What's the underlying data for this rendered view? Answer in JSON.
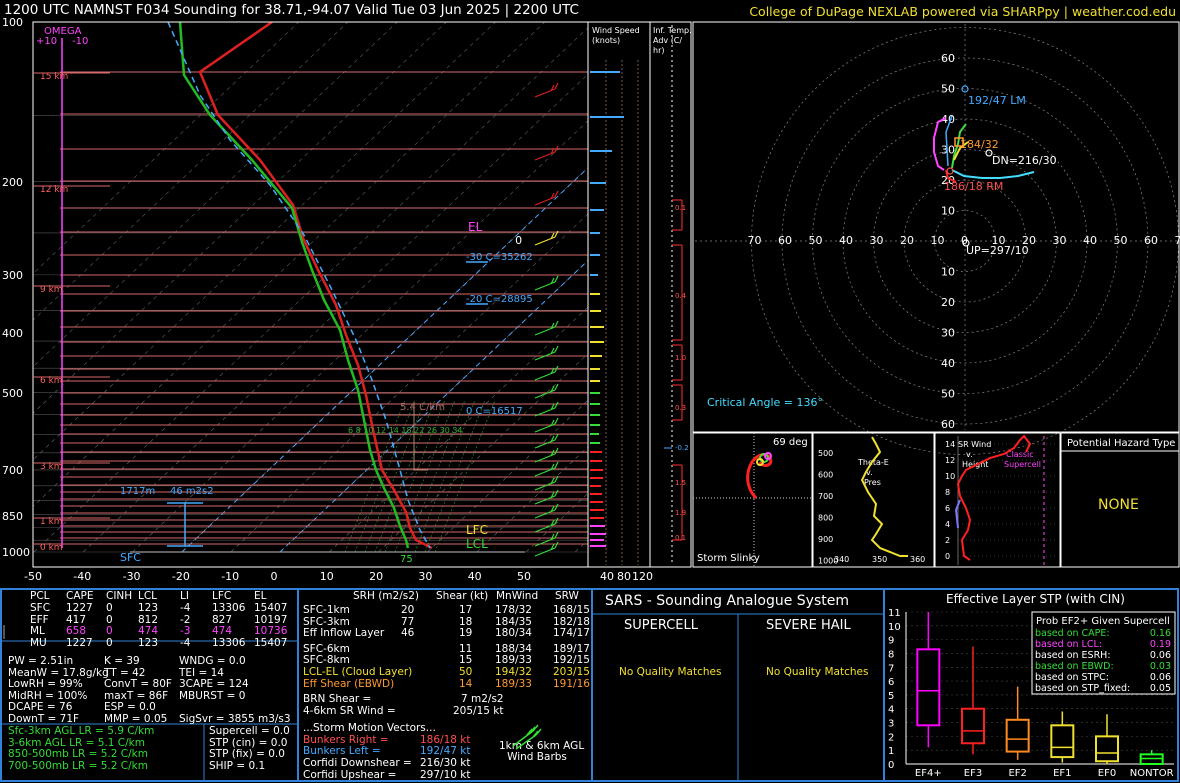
{
  "header": {
    "title": "1200 UTC NAMNST F034 Sounding for 38.71,-94.07 Valid  Tue 03 Jun 2025 | 2200 UTC",
    "credit": "College of DuPage NEXLAB powered via SHARPpy | weather.cod.edu"
  },
  "skewt": {
    "omega_label": "OMEGA",
    "omega_ticks": [
      "+10",
      "-10"
    ],
    "pressure_labels": [
      "100",
      "200",
      "300",
      "400",
      "500",
      "700",
      "850",
      "1000"
    ],
    "temp_labels": [
      "-50",
      "-40",
      "-30",
      "-20",
      "-10",
      "0",
      "10",
      "20",
      "30",
      "40",
      "50"
    ],
    "height_labels": [
      "15 km",
      "12 km",
      "9 km",
      "6 km",
      "3 km",
      "1 km",
      "0 km"
    ],
    "annotations": {
      "el": "EL",
      "lfc": "LFC",
      "lcl": "LCL",
      "sfc": "SFC",
      "iso30": "-30 C=35262",
      "iso20": "-20 C=28895",
      "iso0": "0 C=16517",
      "lapse": "5.4 C/km",
      "pbl": "1717m",
      "dcape": "46 m2s2",
      "sfc_temp": "75",
      "mix_ratios": "6  8  10 12  14  18  22 26 30 34"
    }
  },
  "wind_speed_panel": {
    "title": "Wind Speed (knots)",
    "ticks": [
      "40",
      "80",
      "120"
    ]
  },
  "temp_adv_panel": {
    "title": "Inf. Temp. Adv (C/hr)",
    "labels": [
      "0.1",
      "0.4",
      "1.0",
      "0.3",
      "-0.2",
      "1.5",
      "1.9",
      "0.1"
    ]
  },
  "hodograph": {
    "rings_upper": [
      "60",
      "50",
      "40",
      "30",
      "20",
      "10"
    ],
    "rings_lower": [
      "10",
      "20",
      "30",
      "40",
      "50",
      "60"
    ],
    "axis_left": [
      "0",
      "70",
      "60",
      "50",
      "40",
      "30",
      "20",
      "10"
    ],
    "axis_right": [
      "0",
      "10",
      "20",
      "30",
      "40",
      "50",
      "60",
      "70"
    ],
    "lm": "192/47 LM",
    "mean": "184/32",
    "dn": "DN=216/30",
    "rm": "186/18 RM",
    "up": "UP=297/10",
    "critical_angle": "Critical Angle = 136°"
  },
  "storm_slinky": {
    "angle": "69 deg",
    "label": "Storm Slinky"
  },
  "theta_e": {
    "label": "Theta-E v. Pres",
    "p_ticks": [
      "500",
      "600",
      "700",
      "800",
      "900",
      "1000"
    ],
    "t_ticks": [
      "340",
      "350",
      "360"
    ]
  },
  "sr_wind": {
    "label": "SR Wind v. Height",
    "classic": "Classic Supercell",
    "h_ticks": [
      "14",
      "12",
      "10",
      "8",
      "6",
      "4",
      "2",
      "0"
    ]
  },
  "hazard": {
    "title": "Potential Hazard Type",
    "value": "NONE"
  },
  "parcels": {
    "headers": [
      "PCL",
      "CAPE",
      "CINH",
      "LCL",
      "LI",
      "LFC",
      "EL"
    ],
    "rows": [
      [
        "SFC",
        "1227",
        "0",
        "123",
        "-4",
        "13306",
        "15407"
      ],
      [
        "EFF",
        "417",
        "0",
        "812",
        "-2",
        "827",
        "10197"
      ],
      [
        "ML",
        "658",
        "0",
        "474",
        "-3",
        "474",
        "10736"
      ],
      [
        "MU",
        "1227",
        "0",
        "123",
        "-4",
        "13306",
        "15407"
      ]
    ]
  },
  "indices": [
    [
      "PW = 2.51in",
      "K = 39",
      "WNDG = 0.0"
    ],
    [
      "MeanW = 17.8g/kg",
      "TT = 42",
      "TEI = 14"
    ],
    [
      "LowRH = 99%",
      "ConvT = 80F",
      "3CAPE = 124"
    ],
    [
      "MidRH = 100%",
      "maxT = 86F",
      "MBURST = 0"
    ],
    [
      "DCAPE = 76",
      "ESP = 0.0",
      ""
    ],
    [
      "DownT = 71F",
      "MMP = 0.05",
      "SigSvr = 3855 m3/s3"
    ]
  ],
  "lapse_rates": [
    "Sfc-3km AGL LR = 5.9 C/km",
    "3-6km AGL LR = 5.1 C/km",
    "850-500mb LR = 5.2 C/km",
    "700-500mb LR = 5.2 C/km"
  ],
  "composites": [
    "Supercell = 0.0",
    "STP (cin) = 0.0",
    "STP (fix) = 0.0",
    "SHIP = 0.1"
  ],
  "kinematics": {
    "headers": [
      "SRH (m2/s2)",
      "Shear (kt)",
      "MnWind",
      "SRW"
    ],
    "group1": [
      [
        "SFC-1km",
        "20",
        "17",
        "178/32",
        "168/15"
      ],
      [
        "SFC-3km",
        "77",
        "18",
        "184/35",
        "182/18"
      ],
      [
        "Eff Inflow Layer",
        "46",
        "19",
        "180/34",
        "174/17"
      ]
    ],
    "group2": [
      [
        "SFC-6km",
        "11",
        "188/34",
        "189/17"
      ],
      [
        "SFC-8km",
        "15",
        "189/33",
        "192/15"
      ],
      [
        "LCL-EL (Cloud Layer)",
        "50",
        "194/32",
        "203/15"
      ],
      [
        "Eff Shear (EBWD)",
        "14",
        "189/33",
        "191/16"
      ]
    ],
    "brn_label": "BRN Shear =",
    "brn_value": "7 m2/s2",
    "srw_label": "4-6km SR Wind =",
    "srw_value": "205/15 kt",
    "vectors_title": "...Storm Motion Vectors...",
    "vectors": [
      [
        "Bunkers Right =",
        "186/18 kt"
      ],
      [
        "Bunkers Left =",
        "192/47 kt"
      ],
      [
        "Corfidi Downshear =",
        "216/30 kt"
      ],
      [
        "Corfidi Upshear =",
        "297/10 kt"
      ]
    ],
    "barbs_label1": "1km & 6km AGL",
    "barbs_label2": "Wind Barbs"
  },
  "sars": {
    "title": "SARS - Sounding Analogue System",
    "supercell": "SUPERCELL",
    "hail": "SEVERE HAIL",
    "supercell_msg": "No Quality Matches",
    "hail_msg": "No Quality Matches"
  },
  "stp": {
    "title": "Effective Layer STP (with CIN)",
    "legend_title": "Prob EF2+ Given Supercell",
    "legend": [
      [
        "based on CAPE:",
        "0.16"
      ],
      [
        "based on LCL:",
        "0.19"
      ],
      [
        "based on ESRH:",
        "0.06"
      ],
      [
        "based on EBWD:",
        "0.03"
      ],
      [
        "based on STPC:",
        "0.06"
      ],
      [
        "based on STP_fixed:",
        "0.05"
      ]
    ],
    "y_ticks": [
      "11",
      "10",
      "9",
      "8",
      "7",
      "6",
      "5",
      "4",
      "3",
      "2",
      "1",
      "0"
    ]
  },
  "chart_data": {
    "type": "box",
    "categories": [
      "EF4+",
      "EF3",
      "EF2",
      "EF1",
      "EF0",
      "NONTOR"
    ],
    "boxes": [
      {
        "min": 1.2,
        "q1": 2.8,
        "median": 5.3,
        "q3": 8.3,
        "max": 11
      },
      {
        "min": 0.7,
        "q1": 1.5,
        "median": 2.4,
        "q3": 4.0,
        "max": 8.5
      },
      {
        "min": 0.3,
        "q1": 0.9,
        "median": 1.8,
        "q3": 3.2,
        "max": 5.6
      },
      {
        "min": 0.1,
        "q1": 0.5,
        "median": 1.2,
        "q3": 2.8,
        "max": 3.8
      },
      {
        "min": 0.0,
        "q1": 0.2,
        "median": 0.8,
        "q3": 2.0,
        "max": 3.6
      },
      {
        "min": 0.0,
        "q1": 0.0,
        "median": 0.4,
        "q3": 0.7,
        "max": 1.0
      }
    ],
    "ylim": [
      0,
      11
    ],
    "colors": [
      "#ff00ff",
      "#ff2020",
      "#ff8a20",
      "#f0e030",
      "#f0e030",
      "#20ff20"
    ]
  }
}
